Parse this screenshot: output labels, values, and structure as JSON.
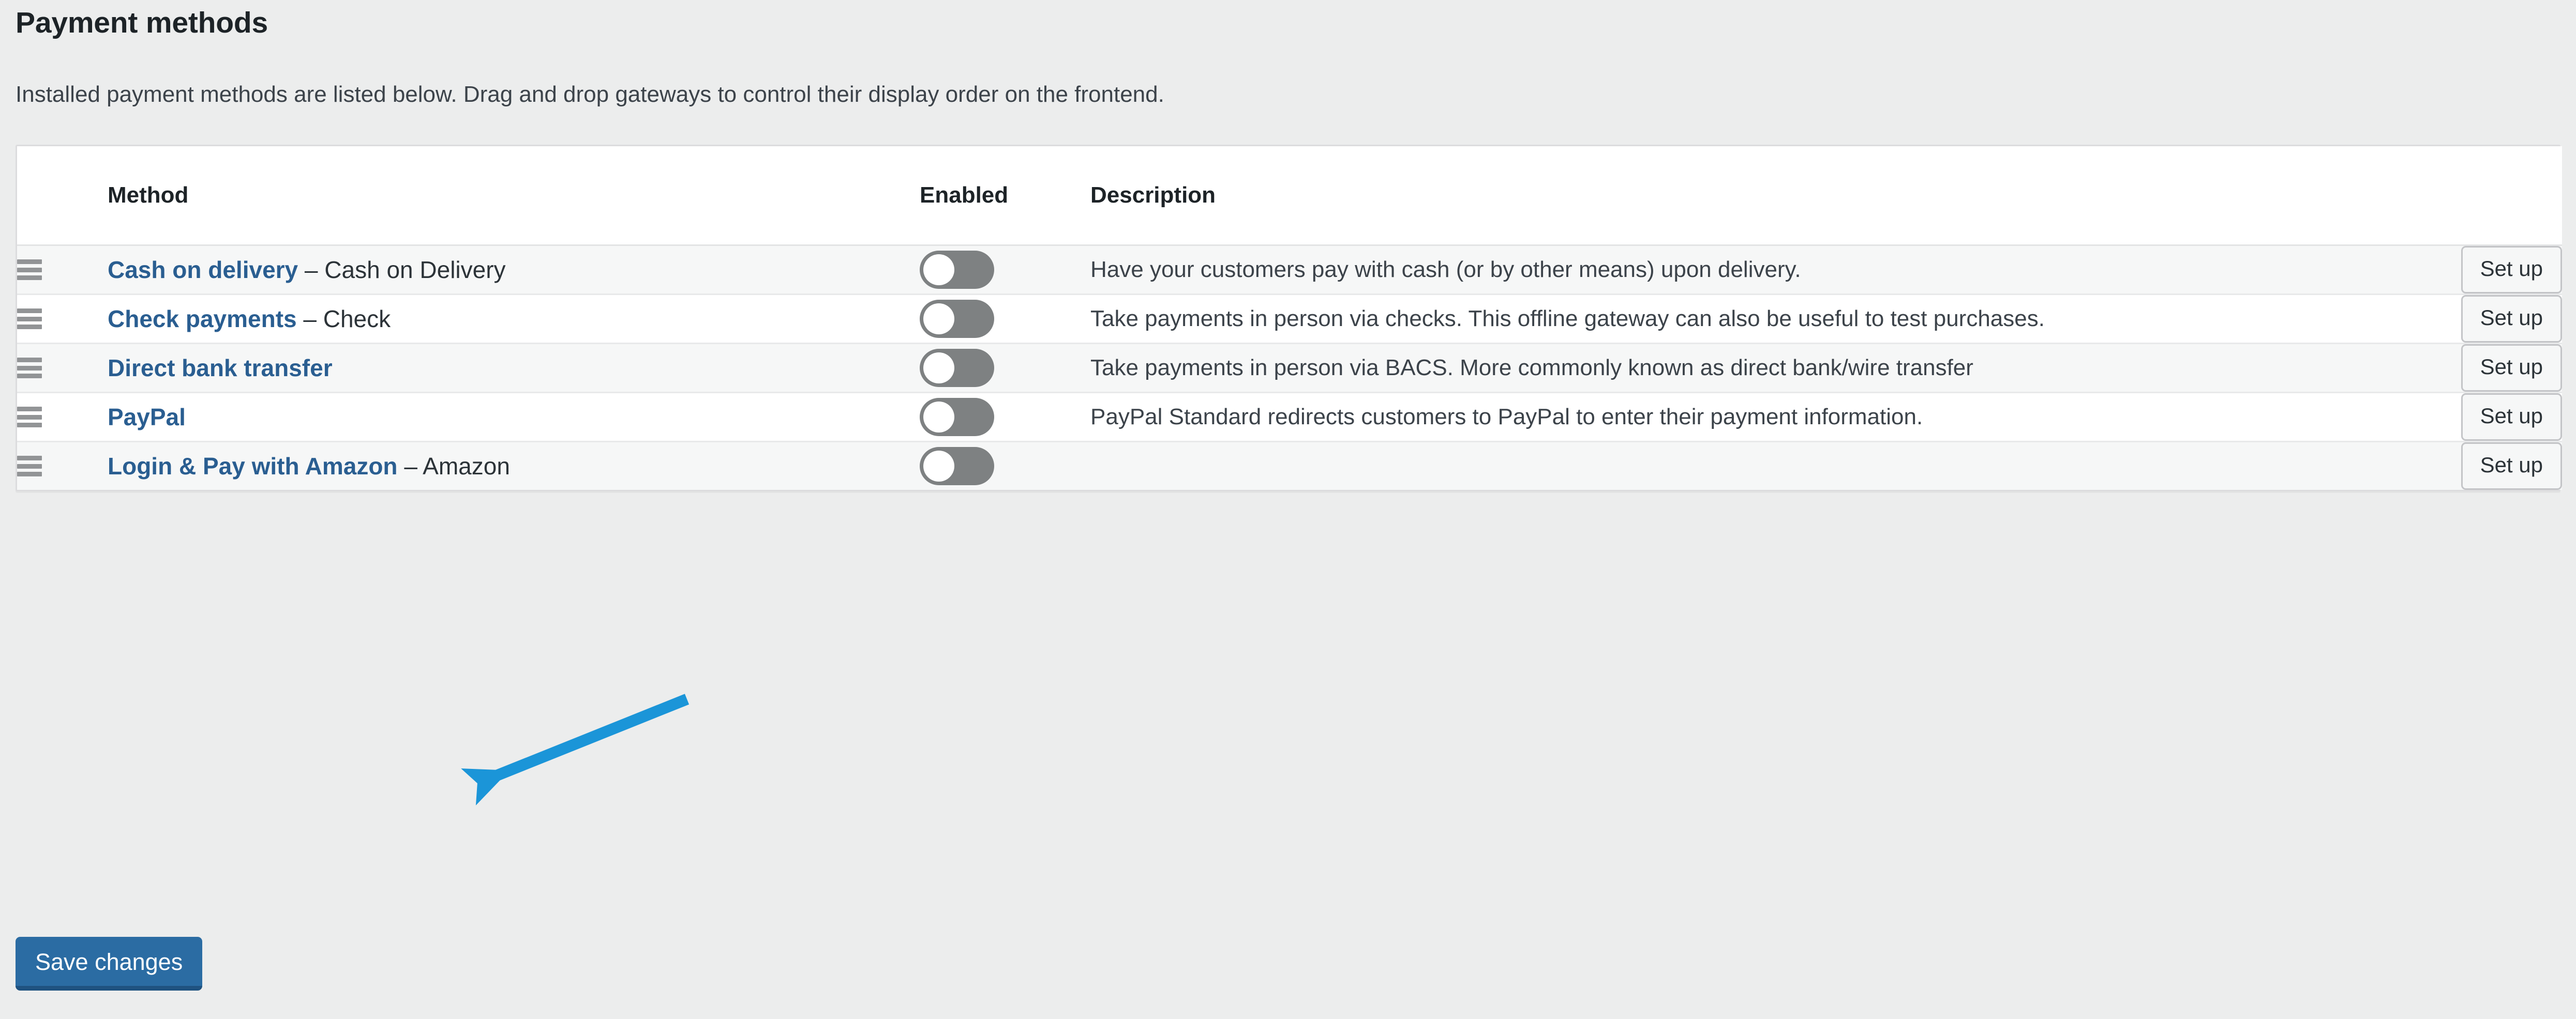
{
  "page": {
    "title": "Payment methods",
    "subtitle": "Installed payment methods are listed below. Drag and drop gateways to control their display order on the frontend."
  },
  "table": {
    "headers": {
      "sort": "",
      "method": "Method",
      "enabled": "Enabled",
      "description": "Description",
      "action": ""
    },
    "rows": [
      {
        "name": "Cash on delivery",
        "suffix": " – Cash on Delivery",
        "enabled": false,
        "description": "Have your customers pay with cash (or by other means) upon delivery.",
        "action_label": "Set up"
      },
      {
        "name": "Check payments",
        "suffix": " – Check",
        "enabled": false,
        "description": "Take payments in person via checks. This offline gateway can also be useful to test purchases.",
        "action_label": "Set up"
      },
      {
        "name": "Direct bank transfer",
        "suffix": "",
        "enabled": false,
        "description": "Take payments in person via BACS. More commonly known as direct bank/wire transfer",
        "action_label": "Set up"
      },
      {
        "name": "PayPal",
        "suffix": "",
        "enabled": false,
        "description": "PayPal Standard redirects customers to PayPal to enter their payment information.",
        "action_label": "Set up"
      },
      {
        "name": "Login & Pay with Amazon",
        "suffix": " – Amazon",
        "enabled": false,
        "description": "",
        "action_label": "Set up"
      }
    ]
  },
  "footer": {
    "save_label": "Save changes"
  },
  "annotation": {
    "color": "#1b95d8"
  },
  "colors": {
    "page_background": "#eceded",
    "card_background": "#ffffff",
    "row_alt_background": "#f6f7f7",
    "link": "#2a5e91",
    "primary_button": "#2b6ca3",
    "toggle_off": "#7e8182"
  }
}
